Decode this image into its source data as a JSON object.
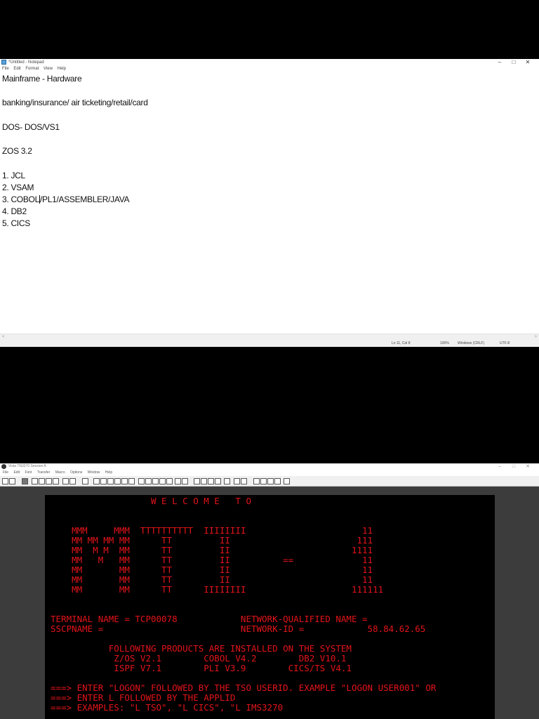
{
  "notepad": {
    "title": "*Untitled - Notepad",
    "menu": [
      "File",
      "Edit",
      "Format",
      "View",
      "Help"
    ],
    "lines": [
      "Mainframe - Hardware",
      "",
      "banking/insurance/ air ticketing/retail/card",
      "",
      "DOS- DOS/VS1",
      "",
      "ZOS 3.2",
      "",
      "1. JCL",
      "2. VSAM",
      "3. COBOL/PL1/ASSEMBLER/JAVA",
      "4. DB2",
      "5. CICS"
    ],
    "status": {
      "position": "Ln 11, Col 8",
      "zoom": "100%",
      "line_ending": "Windows (CRLF)",
      "encoding": "UTF-8"
    }
  },
  "terminal": {
    "title": "Vista TN3270 Session A",
    "menu": [
      "File",
      "Edit",
      "Font",
      "Transfer",
      "Macro",
      "Options",
      "Window",
      "Help"
    ],
    "text_color": "#e3141a",
    "screen_lines": [
      "                   W E L C O M E   T O",
      "",
      "",
      "    MMM     MMM  TTTTTTTTTT  IIIIIIII                      11",
      "    MM MM MM MM      TT         II                        111",
      "    MM  M M  MM      TT         II                       1111",
      "    MM   M   MM      TT         II          ==             11",
      "    MM       MM      TT         II                         11",
      "    MM       MM      TT         II                         11",
      "    MM       MM      TT      IIIIIIII                    111111",
      "",
      "",
      "TERMINAL NAME = TCP00078            NETWORK-QUALIFIED NAME =",
      "SSCPNAME =                          NETWORK-ID =            58.84.62.65",
      "",
      "",
      "           FOLLOWING PRODUCTS ARE INSTALLED ON THE SYSTEM",
      "            Z/OS V2.1        COBOL V4.2        DB2 V10.1",
      "            ISPF V7.1        PLI V3.9        CICS/TS V4.1",
      "",
      "===> ENTER \"LOGON\" FOLLOWED BY THE TSO USERID. EXAMPLE \"LOGON USER001\" OR",
      "===> ENTER L FOLLOWED BY THE APPLID",
      "===> EXAMPLES: \"L TSO\", \"L CICS\", \"L IMS3270"
    ]
  }
}
